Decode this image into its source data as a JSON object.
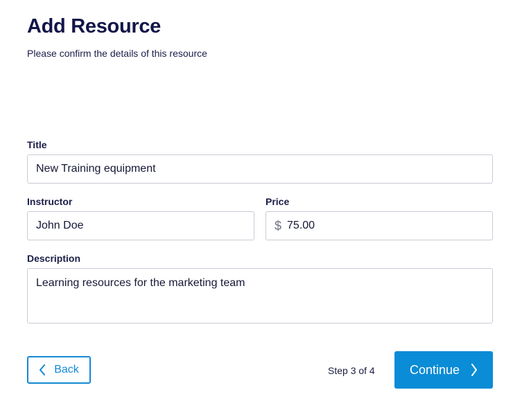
{
  "header": {
    "title": "Add Resource",
    "subtitle": "Please confirm the details of this resource"
  },
  "form": {
    "title": {
      "label": "Title",
      "value": "New Training equipment"
    },
    "instructor": {
      "label": "Instructor",
      "value": "John Doe"
    },
    "price": {
      "label": "Price",
      "currency_symbol": "$",
      "value": "75.00"
    },
    "description": {
      "label": "Description",
      "value": "Learning resources for the marketing team"
    }
  },
  "footer": {
    "back_label": "Back",
    "step_text": "Step 3 of 4",
    "continue_label": "Continue"
  },
  "colors": {
    "accent": "#0a8cd6",
    "heading": "#121548",
    "border": "#c9ccd6"
  },
  "icons": {
    "back": "chevron-left-icon",
    "continue": "chevron-right-icon"
  }
}
